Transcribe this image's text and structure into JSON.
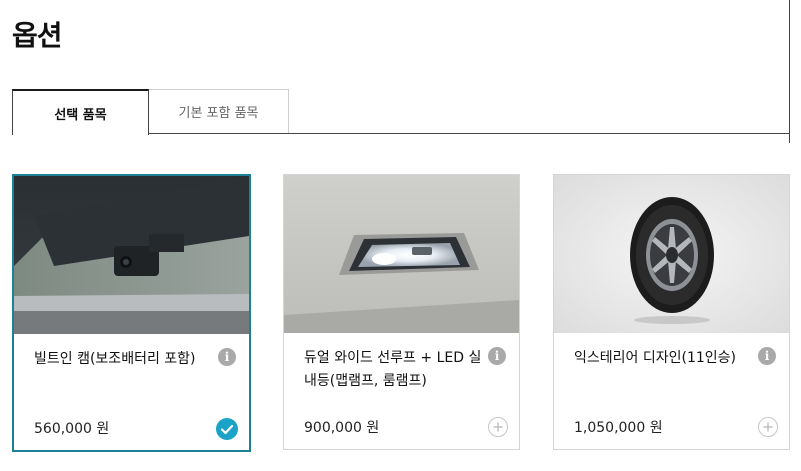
{
  "page": {
    "title": "옵션"
  },
  "tabs": [
    {
      "label": "선택 품목",
      "selected": true
    },
    {
      "label": "기본 포함 품목",
      "selected": false
    }
  ],
  "options": [
    {
      "name": "빌트인 캠(보조배터리 포함)",
      "price": "560,000 원",
      "selected": true,
      "image_icon": "dashcam-image",
      "action_icon": "check-icon"
    },
    {
      "name": "듀얼 와이드 선루프 + LED 실내등(맵램프, 룸램프)",
      "price": "900,000 원",
      "selected": false,
      "image_icon": "interior-lamp-image",
      "action_icon": "plus-icon"
    },
    {
      "name": "익스테리어 디자인(11인승)",
      "price": "1,050,000 원",
      "selected": false,
      "image_icon": "wheel-image",
      "action_icon": "plus-icon"
    }
  ],
  "colors": {
    "accent": "#1aa3c7",
    "selected_border": "#1d8096",
    "info_icon": "#a9a9a9"
  }
}
